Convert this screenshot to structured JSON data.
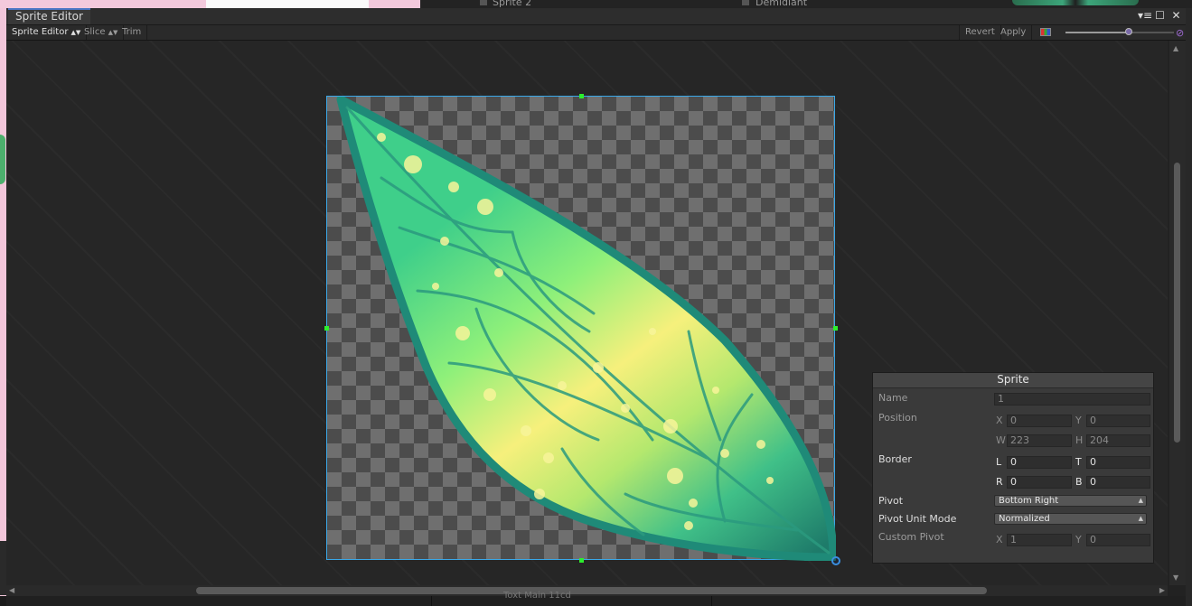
{
  "background": {
    "left_item": "Sprite 2",
    "right_item": "Demidiant",
    "bottom_text": "Toxt Main 11cd"
  },
  "window": {
    "title": "Sprite Editor",
    "icons": [
      "menu-icon",
      "maximize-icon",
      "close-icon"
    ]
  },
  "toolbar": {
    "mode_label": "Sprite Editor",
    "slice_label": "Slice",
    "trim_label": "Trim",
    "revert_label": "Revert",
    "apply_label": "Apply",
    "zoom_level": 0.58
  },
  "panel": {
    "title": "Sprite",
    "name_label": "Name",
    "name_value": "1",
    "position_label": "Position",
    "x_label": "X",
    "x_value": "0",
    "y_label": "Y",
    "y_value": "0",
    "w_label": "W",
    "w_value": "223",
    "h_label": "H",
    "h_value": "204",
    "border_label": "Border",
    "l_label": "L",
    "l_value": "0",
    "t_label": "T",
    "t_value": "0",
    "r_label": "R",
    "r_value": "0",
    "b_label": "B",
    "b_value": "0",
    "pivot_label": "Pivot",
    "pivot_value": "Bottom Right",
    "pivot_unit_label": "Pivot Unit Mode",
    "pivot_unit_value": "Normalized",
    "custom_pivot_label": "Custom Pivot",
    "cp_x_label": "X",
    "cp_x_value": "1",
    "cp_y_label": "Y",
    "cp_y_value": "0"
  },
  "colors": {
    "selection_border": "#3aa8e8",
    "handle": "#2dee2d",
    "leaf_light": "#f6f07c",
    "leaf_mid": "#52d888",
    "leaf_dark": "#1e7b6a"
  }
}
